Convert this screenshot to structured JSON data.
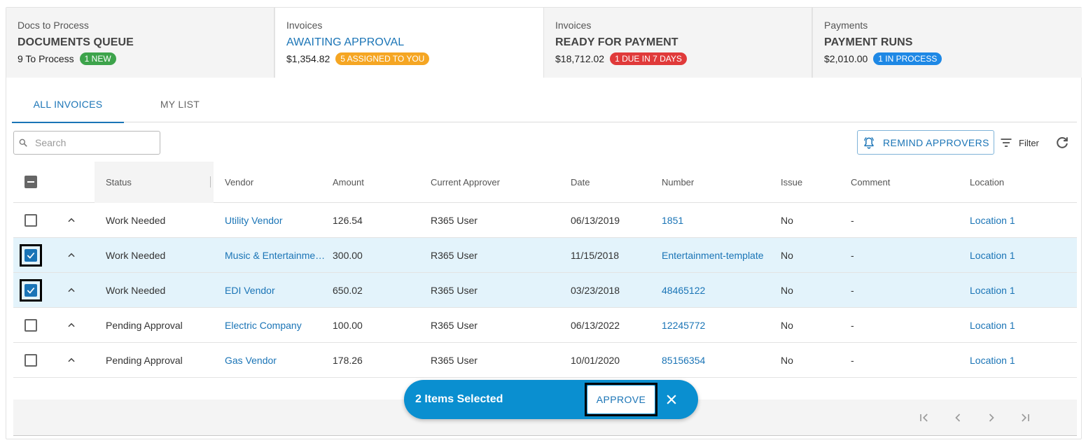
{
  "stages": [
    {
      "kicker": "Docs to Process",
      "title": "DOCUMENTS QUEUE",
      "amount": "9 To Process",
      "badge": "1 NEW",
      "badge_color": "#3da34b"
    },
    {
      "kicker": "Invoices",
      "title": "AWAITING APPROVAL",
      "amount": "$1,354.82",
      "badge": "5 ASSIGNED TO YOU",
      "badge_color": "#f5a623"
    },
    {
      "kicker": "Invoices",
      "title": "READY FOR PAYMENT",
      "amount": "$18,712.02",
      "badge": "1 DUE IN 7 DAYS",
      "badge_color": "#e03a3a"
    },
    {
      "kicker": "Payments",
      "title": "PAYMENT RUNS",
      "amount": "$2,010.00",
      "badge": "1 IN PROCESS",
      "badge_color": "#1e88e5"
    }
  ],
  "tabs": {
    "all": "ALL INVOICES",
    "mine": "MY LIST"
  },
  "toolbar": {
    "search_placeholder": "Search",
    "remind_label": "REMIND APPROVERS",
    "filter_label": "Filter"
  },
  "table": {
    "columns": {
      "status": "Status",
      "vendor": "Vendor",
      "amount": "Amount",
      "approver": "Current Approver",
      "date": "Date",
      "number": "Number",
      "issue": "Issue",
      "comment": "Comment",
      "location": "Location"
    },
    "rows": [
      {
        "status": "Work Needed",
        "vendor": "Utility Vendor",
        "amount": "126.54",
        "approver": "R365 User",
        "date": "06/13/2019",
        "number": "1851",
        "issue": "No",
        "comment": "-",
        "location": "Location 1",
        "selected": false
      },
      {
        "status": "Work Needed",
        "vendor": "Music & Entertainment Vendor",
        "amount": "300.00",
        "approver": "R365 User",
        "date": "11/15/2018",
        "number": "Entertainment-template",
        "issue": "No",
        "comment": "-",
        "location": "Location 1",
        "selected": true
      },
      {
        "status": "Work Needed",
        "vendor": "EDI Vendor",
        "amount": "650.02",
        "approver": "R365 User",
        "date": "03/23/2018",
        "number": "48465122",
        "issue": "No",
        "comment": "-",
        "location": "Location 1",
        "selected": true
      },
      {
        "status": "Pending Approval",
        "vendor": "Electric Company",
        "amount": "100.00",
        "approver": "R365 User",
        "date": "06/13/2022",
        "number": "12245772",
        "issue": "No",
        "comment": "-",
        "location": "Location 1",
        "selected": false
      },
      {
        "status": "Pending Approval",
        "vendor": "Gas Vendor",
        "amount": "178.26",
        "approver": "R365 User",
        "date": "10/01/2020",
        "number": "85156354",
        "issue": "No",
        "comment": "-",
        "location": "Location 1",
        "selected": false
      }
    ]
  },
  "selection_bar": {
    "count_label": "2 Items Selected",
    "approve_label": "APPROVE"
  },
  "colors": {
    "accent": "#1a74b6",
    "selection_bar": "#0a8fd0",
    "selected_row": "#e3f3fb"
  }
}
